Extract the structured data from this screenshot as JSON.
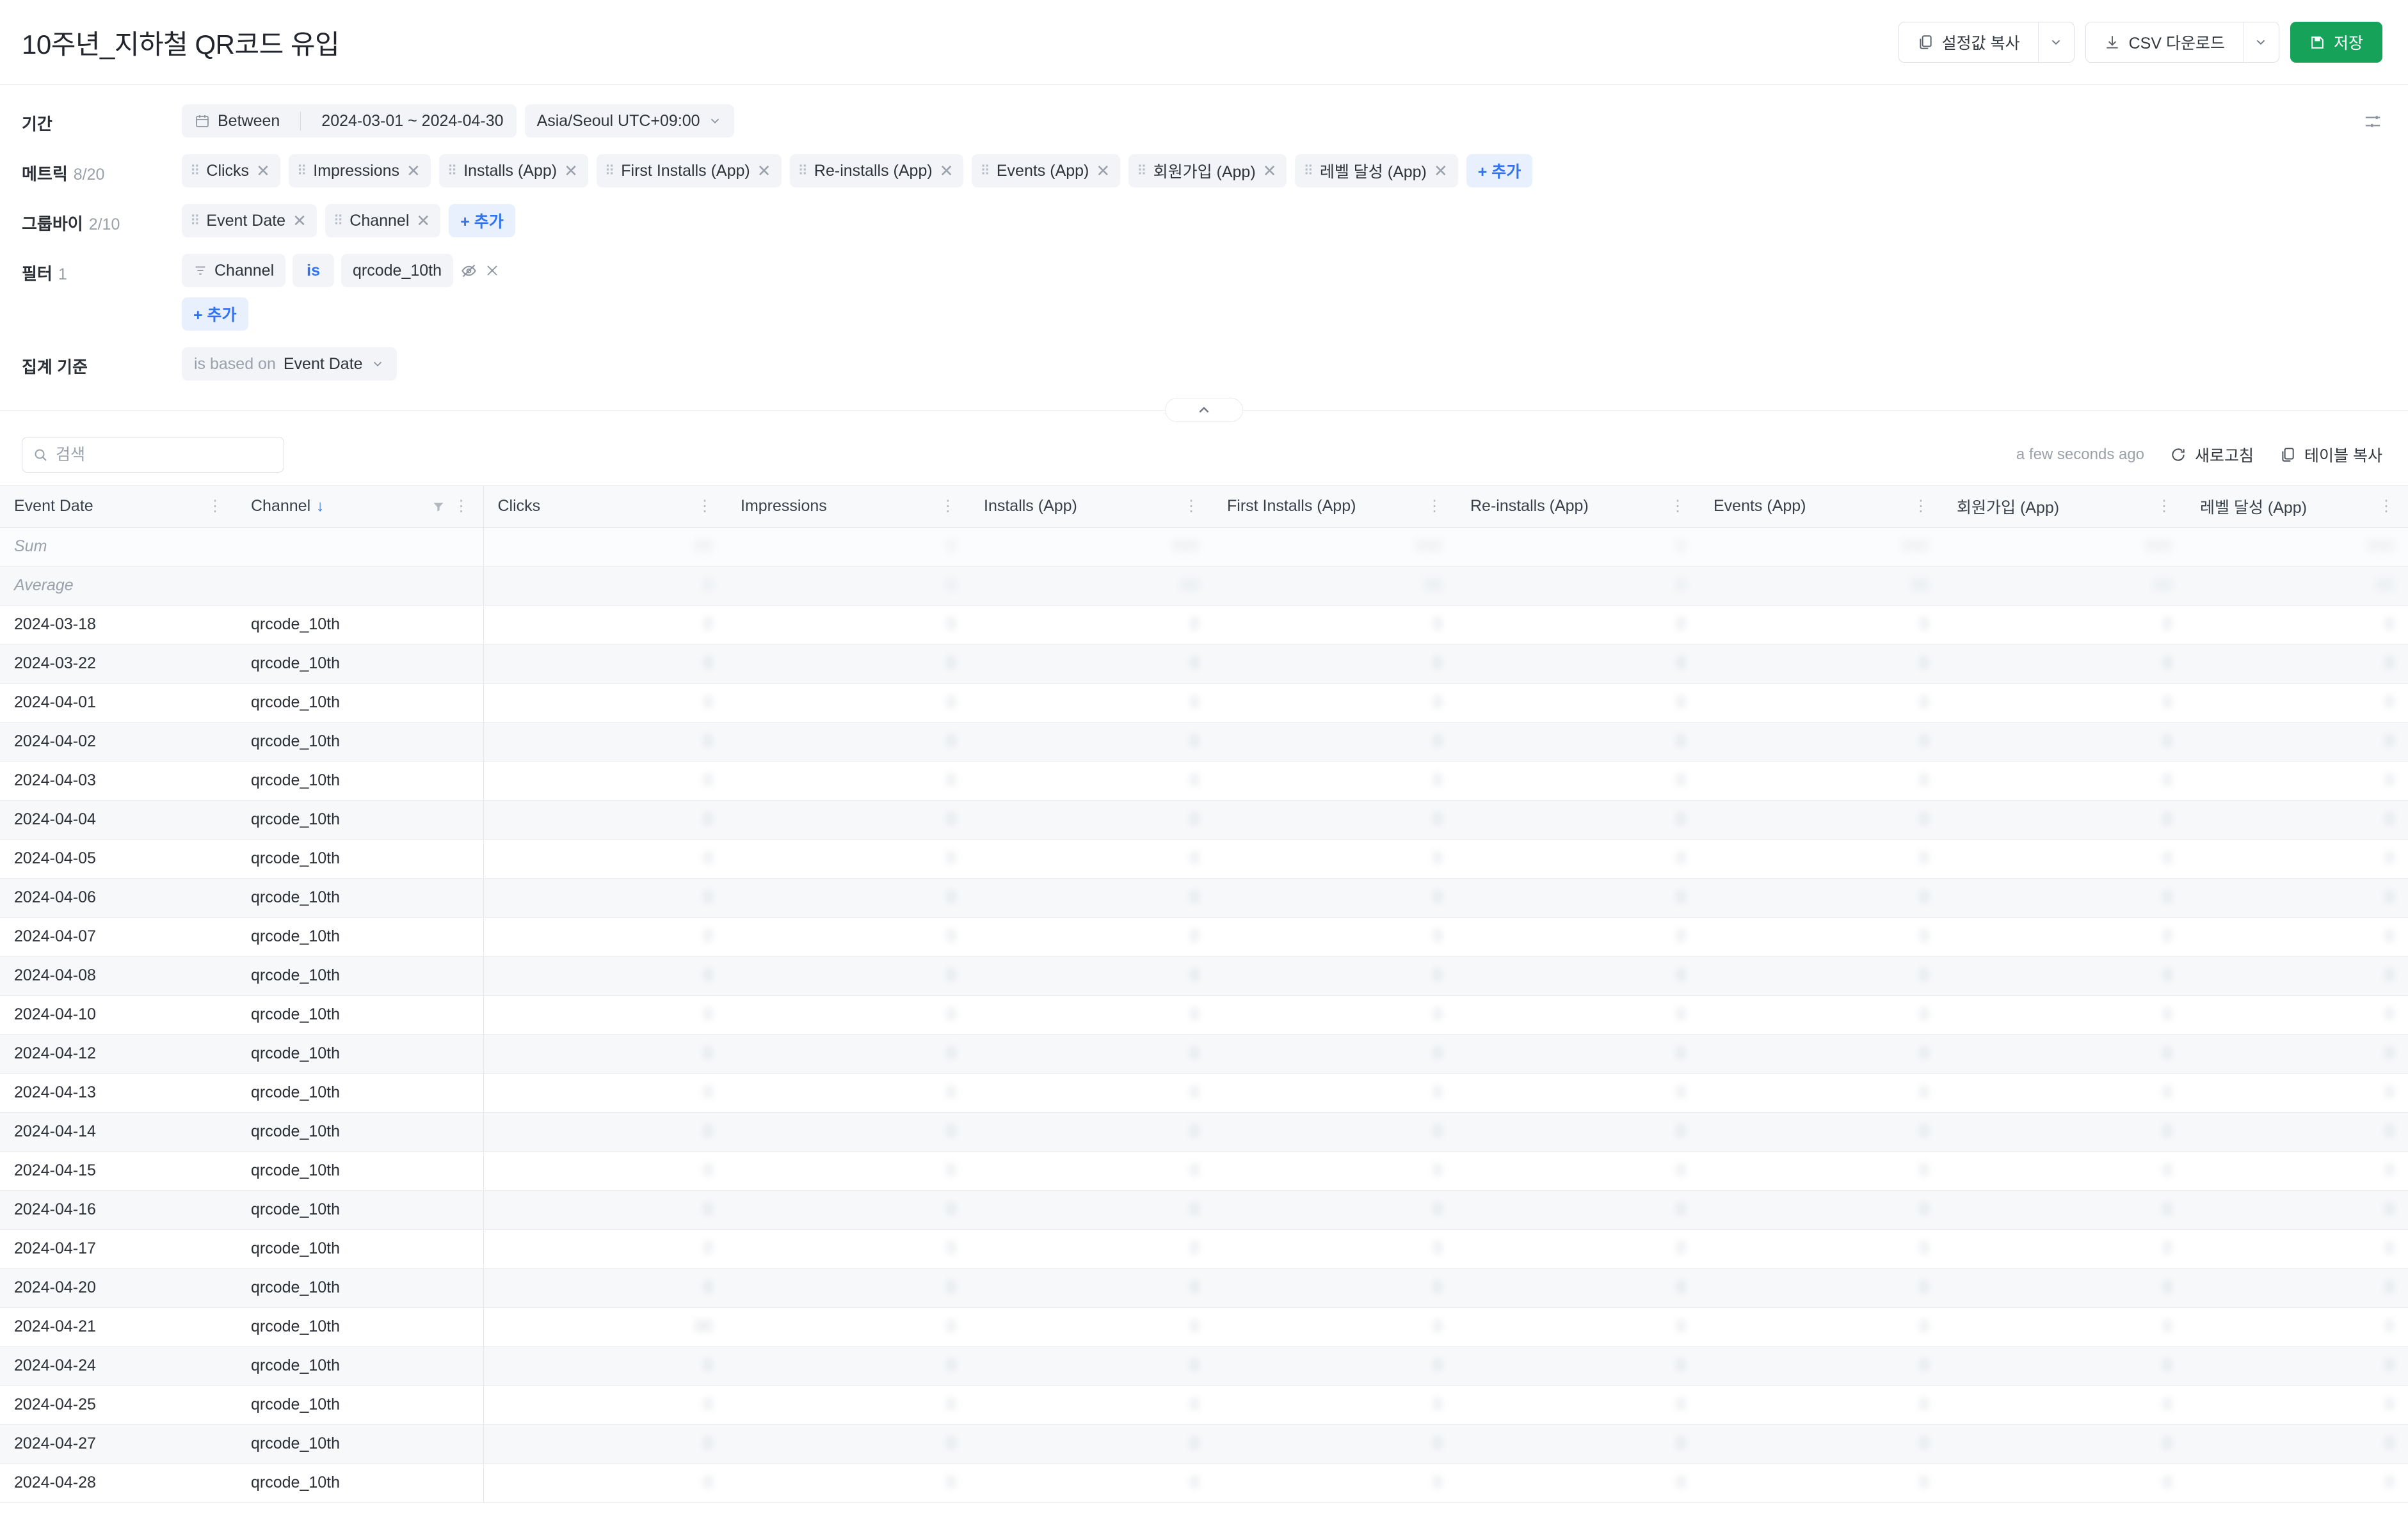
{
  "header": {
    "title": "10주년_지하철 QR코드 유입",
    "copy_settings_label": "설정값 복사",
    "csv_download_label": "CSV 다운로드",
    "save_label": "저장",
    "icons": {
      "copy": "copy-icon",
      "download": "download-icon",
      "save": "save-icon",
      "caret": "chevron-down-icon"
    }
  },
  "query": {
    "period": {
      "label": "기간",
      "mode": "Between",
      "range": "2024-03-01 ~ 2024-04-30",
      "timezone": "Asia/Seoul UTC+09:00"
    },
    "metrics": {
      "label": "메트릭",
      "count": "8/20",
      "items": [
        {
          "label": "Clicks"
        },
        {
          "label": "Impressions"
        },
        {
          "label": "Installs (App)"
        },
        {
          "label": "First Installs (App)"
        },
        {
          "label": "Re-installs (App)"
        },
        {
          "label": "Events (App)"
        },
        {
          "label": "회원가입 (App)"
        },
        {
          "label": "레벨 달성 (App)"
        }
      ],
      "add_label": "+ 추가"
    },
    "groupby": {
      "label": "그룹바이",
      "count": "2/10",
      "items": [
        {
          "label": "Event Date"
        },
        {
          "label": "Channel"
        }
      ],
      "add_label": "+ 추가"
    },
    "filter": {
      "label": "필터",
      "count": "1",
      "field": "Channel",
      "operator": "is",
      "value": "qrcode_10th",
      "add_label": "+ 추가"
    },
    "aggregation": {
      "label": "집계 기준",
      "prefix": "is based on",
      "value": "Event Date"
    },
    "settings_icon": "sliders-icon",
    "collapse_icon": "chevron-up-icon"
  },
  "toolbar": {
    "search_placeholder": "검색",
    "search_value": "",
    "last_updated": "a few seconds ago",
    "refresh_label": "새로고침",
    "copy_table_label": "테이블 복사"
  },
  "table": {
    "columns": [
      {
        "key": "event_date",
        "label": "Event Date",
        "type": "text",
        "sorted": false,
        "filtered": false
      },
      {
        "key": "channel",
        "label": "Channel",
        "type": "text",
        "sorted": true,
        "sort_dir": "desc",
        "filtered": true
      },
      {
        "key": "clicks",
        "label": "Clicks",
        "type": "num"
      },
      {
        "key": "impressions",
        "label": "Impressions",
        "type": "num"
      },
      {
        "key": "installs_app",
        "label": "Installs (App)",
        "type": "num"
      },
      {
        "key": "first_installs_app",
        "label": "First Installs (App)",
        "type": "num"
      },
      {
        "key": "re_installs_app",
        "label": "Re-installs (App)",
        "type": "num"
      },
      {
        "key": "events_app",
        "label": "Events (App)",
        "type": "num"
      },
      {
        "key": "signup_app",
        "label": "회원가입 (App)",
        "type": "num"
      },
      {
        "key": "level_app",
        "label": "레벨 달성 (App)",
        "type": "num"
      }
    ],
    "aggregate_rows": [
      {
        "label": "Sum",
        "values": [
          "00",
          "0",
          "000",
          "000",
          "0",
          "000",
          "000",
          "000"
        ]
      },
      {
        "label": "Average",
        "values": [
          "0",
          "0",
          "00",
          "00",
          "0",
          "00",
          "00",
          "00"
        ]
      }
    ],
    "rows": [
      {
        "event_date": "2024-03-18",
        "channel": "qrcode_10th",
        "values": [
          "0",
          "0",
          "0",
          "0",
          "0",
          "0",
          "0",
          "0"
        ]
      },
      {
        "event_date": "2024-03-22",
        "channel": "qrcode_10th",
        "values": [
          "0",
          "0",
          "0",
          "0",
          "0",
          "0",
          "0",
          "0"
        ]
      },
      {
        "event_date": "2024-04-01",
        "channel": "qrcode_10th",
        "values": [
          "0",
          "0",
          "0",
          "0",
          "0",
          "0",
          "0",
          "0"
        ]
      },
      {
        "event_date": "2024-04-02",
        "channel": "qrcode_10th",
        "values": [
          "0",
          "0",
          "0",
          "0",
          "0",
          "0",
          "0",
          "0"
        ]
      },
      {
        "event_date": "2024-04-03",
        "channel": "qrcode_10th",
        "values": [
          "0",
          "0",
          "0",
          "0",
          "0",
          "0",
          "0",
          "0"
        ]
      },
      {
        "event_date": "2024-04-04",
        "channel": "qrcode_10th",
        "values": [
          "0",
          "0",
          "0",
          "0",
          "0",
          "0",
          "0",
          "0"
        ]
      },
      {
        "event_date": "2024-04-05",
        "channel": "qrcode_10th",
        "values": [
          "0",
          "0",
          "0",
          "0",
          "0",
          "0",
          "0",
          "0"
        ]
      },
      {
        "event_date": "2024-04-06",
        "channel": "qrcode_10th",
        "values": [
          "0",
          "0",
          "0",
          "0",
          "0",
          "0",
          "0",
          "0"
        ]
      },
      {
        "event_date": "2024-04-07",
        "channel": "qrcode_10th",
        "values": [
          "0",
          "0",
          "0",
          "0",
          "0",
          "0",
          "0",
          "0"
        ]
      },
      {
        "event_date": "2024-04-08",
        "channel": "qrcode_10th",
        "values": [
          "0",
          "0",
          "0",
          "0",
          "0",
          "0",
          "0",
          "0"
        ]
      },
      {
        "event_date": "2024-04-10",
        "channel": "qrcode_10th",
        "values": [
          "0",
          "0",
          "0",
          "0",
          "0",
          "0",
          "0",
          "0"
        ]
      },
      {
        "event_date": "2024-04-12",
        "channel": "qrcode_10th",
        "values": [
          "0",
          "0",
          "0",
          "0",
          "0",
          "0",
          "0",
          "0"
        ]
      },
      {
        "event_date": "2024-04-13",
        "channel": "qrcode_10th",
        "values": [
          "0",
          "0",
          "0",
          "0",
          "0",
          "0",
          "0",
          "0"
        ]
      },
      {
        "event_date": "2024-04-14",
        "channel": "qrcode_10th",
        "values": [
          "0",
          "0",
          "0",
          "0",
          "0",
          "0",
          "0",
          "0"
        ]
      },
      {
        "event_date": "2024-04-15",
        "channel": "qrcode_10th",
        "values": [
          "0",
          "0",
          "0",
          "0",
          "0",
          "0",
          "0",
          "0"
        ]
      },
      {
        "event_date": "2024-04-16",
        "channel": "qrcode_10th",
        "values": [
          "0",
          "0",
          "0",
          "0",
          "0",
          "0",
          "0",
          "0"
        ]
      },
      {
        "event_date": "2024-04-17",
        "channel": "qrcode_10th",
        "values": [
          "0",
          "0",
          "0",
          "0",
          "0",
          "0",
          "0",
          "0"
        ]
      },
      {
        "event_date": "2024-04-20",
        "channel": "qrcode_10th",
        "values": [
          "0",
          "0",
          "0",
          "0",
          "0",
          "0",
          "0",
          "0"
        ]
      },
      {
        "event_date": "2024-04-21",
        "channel": "qrcode_10th",
        "values": [
          "00",
          "0",
          "0",
          "0",
          "0",
          "0",
          "0",
          "0"
        ]
      },
      {
        "event_date": "2024-04-24",
        "channel": "qrcode_10th",
        "values": [
          "0",
          "0",
          "0",
          "0",
          "0",
          "0",
          "0",
          "0"
        ]
      },
      {
        "event_date": "2024-04-25",
        "channel": "qrcode_10th",
        "values": [
          "0",
          "0",
          "0",
          "0",
          "0",
          "0",
          "0",
          "0"
        ]
      },
      {
        "event_date": "2024-04-27",
        "channel": "qrcode_10th",
        "values": [
          "0",
          "0",
          "0",
          "0",
          "0",
          "0",
          "0",
          "0"
        ]
      },
      {
        "event_date": "2024-04-28",
        "channel": "qrcode_10th",
        "values": [
          "0",
          "0",
          "0",
          "0",
          "0",
          "0",
          "0",
          "0"
        ]
      }
    ]
  },
  "colors": {
    "accent_blue": "#2f72f2",
    "save_green": "#17a25a",
    "chip_bg": "#f2f4f7",
    "header_bg": "#f8f9fb"
  }
}
